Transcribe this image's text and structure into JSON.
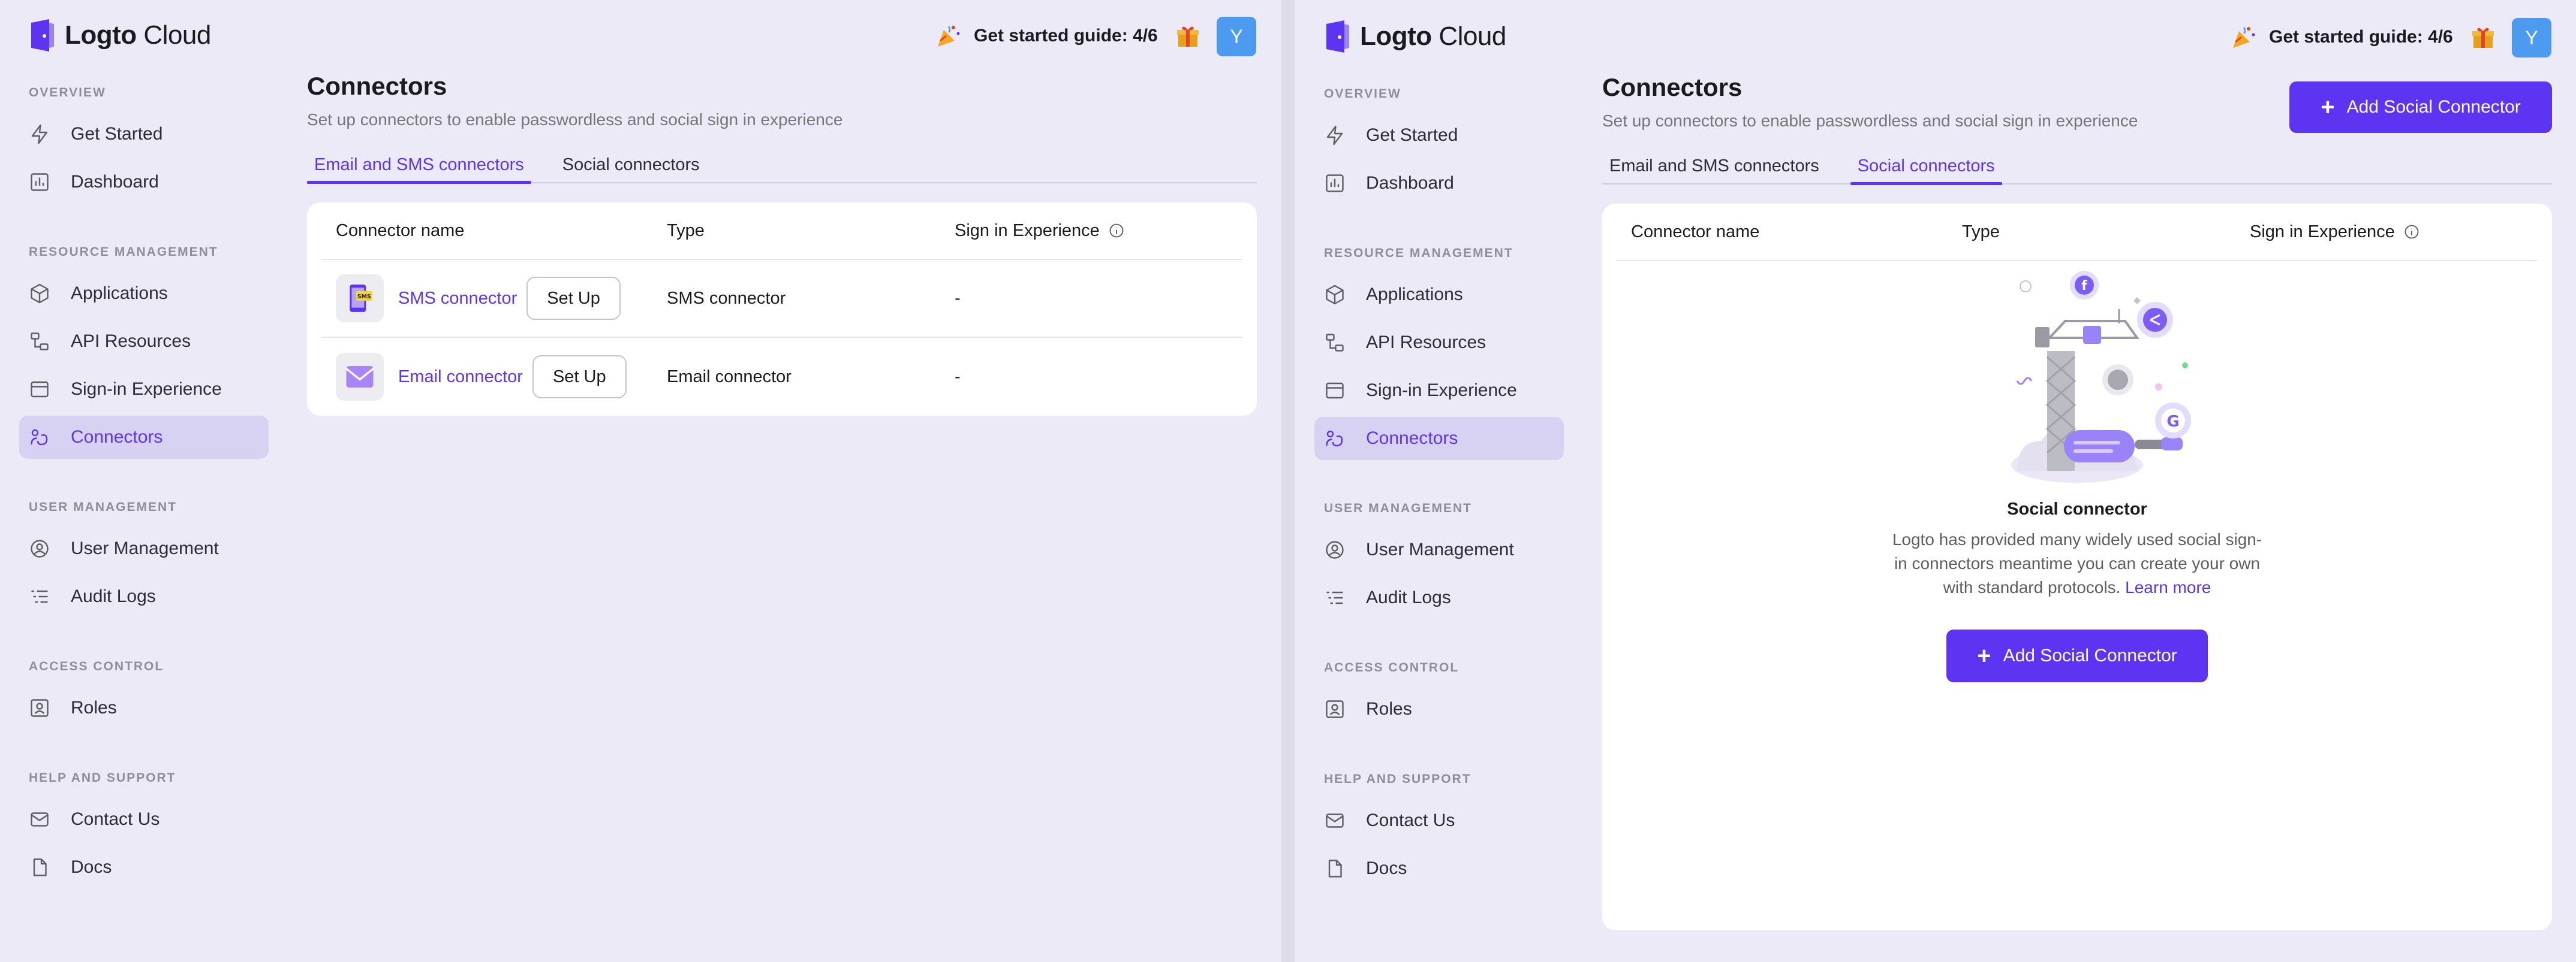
{
  "app": {
    "brand": "Logto",
    "brand_suffix": "Cloud",
    "guide_text": "Get started guide: 4/6",
    "avatar_initial": "Y"
  },
  "sidebar": {
    "sections": {
      "overview": "OVERVIEW",
      "resource_management": "RESOURCE MANAGEMENT",
      "user_management": "USER MANAGEMENT",
      "access_control": "ACCESS CONTROL",
      "help_support": "HELP AND SUPPORT"
    },
    "items": {
      "get_started": "Get Started",
      "dashboard": "Dashboard",
      "applications": "Applications",
      "api_resources": "API Resources",
      "sign_in_experience": "Sign-in Experience",
      "connectors": "Connectors",
      "user_management": "User Management",
      "audit_logs": "Audit Logs",
      "roles": "Roles",
      "contact_us": "Contact Us",
      "docs": "Docs"
    }
  },
  "page": {
    "title": "Connectors",
    "subtitle": "Set up connectors to enable passwordless and social sign in experience",
    "tabs": {
      "email_sms": "Email and SMS connectors",
      "social": "Social connectors"
    }
  },
  "table": {
    "headers": {
      "name": "Connector name",
      "type": "Type",
      "sie": "Sign in Experience"
    },
    "rows": [
      {
        "name": "SMS connector",
        "action": "Set Up",
        "type": "SMS connector",
        "sie": "-",
        "icon": "sms-icon"
      },
      {
        "name": "Email connector",
        "action": "Set Up",
        "type": "Email connector",
        "sie": "-",
        "icon": "email-icon"
      }
    ]
  },
  "social": {
    "add_button": "Add Social Connector",
    "empty_title": "Social connector",
    "empty_desc": "Logto has provided many widely used social sign-in connectors meantime you can create your own with standard protocols.",
    "learn_more": "Learn more"
  },
  "colors": {
    "accent": "#5D34F2",
    "avatar": "#4C9BF1",
    "active_nav_bg": "#D8D2F2"
  }
}
